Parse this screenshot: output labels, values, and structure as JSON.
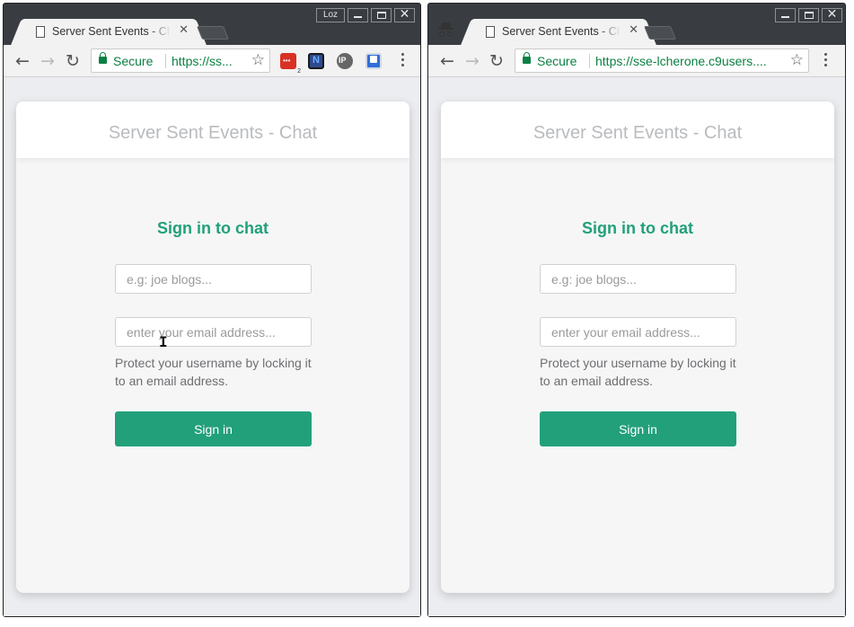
{
  "windows": [
    {
      "side": "left",
      "profile_label": "Loz",
      "tab_title": "Server Sent Events - Chat",
      "secure_label": "Secure",
      "url": "https://ss...",
      "extensions": [
        "lastpass-icon",
        "nimbus-icon",
        "ip-icon",
        "screencast-icon"
      ],
      "extension_badge": "2",
      "incognito": false
    },
    {
      "side": "right",
      "tab_title": "Server Sent Events - Chat",
      "secure_label": "Secure",
      "url": "https://sse-lcherone.c9users....",
      "incognito": true
    }
  ],
  "app": {
    "header_title": "Server Sent Events - Chat",
    "signin_title": "Sign in to chat",
    "name_placeholder": "e.g: joe blogs...",
    "email_placeholder": "enter your email address...",
    "hint": "Protect your username by locking it to an email address.",
    "button_label": "Sign in"
  },
  "colors": {
    "accent": "#22a07a",
    "frame": "#393d42",
    "page_bg": "#ecedf0"
  }
}
